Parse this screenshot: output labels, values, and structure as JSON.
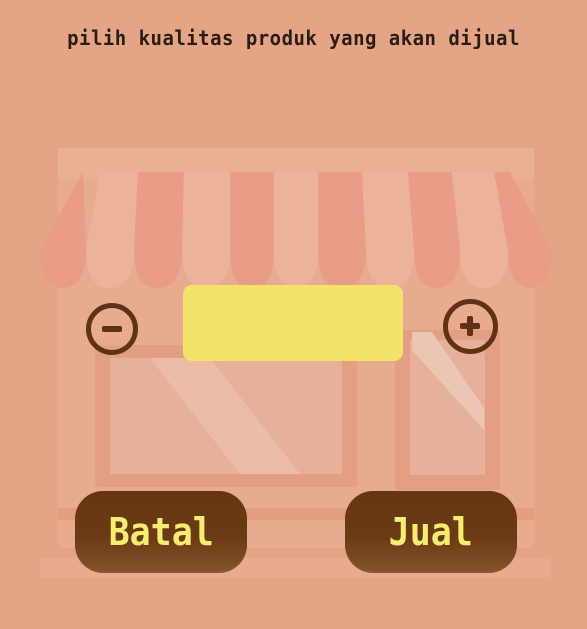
{
  "prompt": {
    "text": "pilih kualitas produk yang akan dijual"
  },
  "quantity": {
    "value": ""
  },
  "buttons": {
    "cancel_label": "Batal",
    "sell_label": "Jual"
  },
  "icons": {
    "decrease": "minus-circle-icon",
    "increase": "plus-circle-icon"
  },
  "colors": {
    "background": "#e4a486",
    "accent": "#f3e36b",
    "button": "#6b3a15",
    "button_text": "#f6ec71",
    "text": "#2b1d14"
  }
}
